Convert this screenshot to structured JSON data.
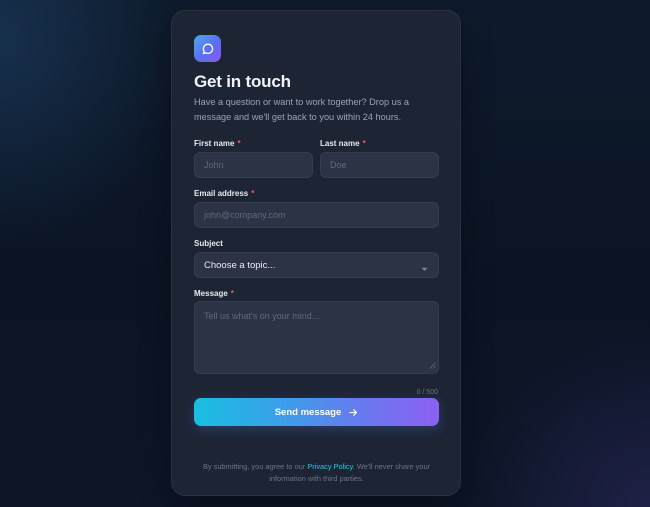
{
  "header": {
    "logo_icon": "chat-bubble-icon",
    "title": "Get in touch",
    "subtitle": "Have a question or want to work together? Drop us a message and we'll get back to you within 24 hours."
  },
  "form": {
    "required_marker": "*",
    "first_name": {
      "label": "First name",
      "placeholder": "John",
      "value": ""
    },
    "last_name": {
      "label": "Last name",
      "placeholder": "Doe",
      "value": ""
    },
    "email": {
      "label": "Email address",
      "placeholder": "john@company.com",
      "value": ""
    },
    "subject": {
      "label": "Subject",
      "selected": "Choose a topic...",
      "icon": "chevron-down-icon"
    },
    "message": {
      "label": "Message",
      "placeholder": "Tell us what's on your mind...",
      "value": "",
      "counter": "0 / 500"
    },
    "submit": {
      "label": "Send message",
      "icon": "arrow-right-icon"
    }
  },
  "footer": {
    "text_before": "By submitting, you agree to our ",
    "link": "Privacy Policy",
    "text_after": ". We'll never share your information with third parties."
  },
  "colors": {
    "background": "#0b1424",
    "card": "#1d2535",
    "input": "#2b3345",
    "accent_start": "#18bfe0",
    "accent_end": "#8c60f2",
    "required": "#ef5a6a",
    "link": "#2fc4e6"
  }
}
